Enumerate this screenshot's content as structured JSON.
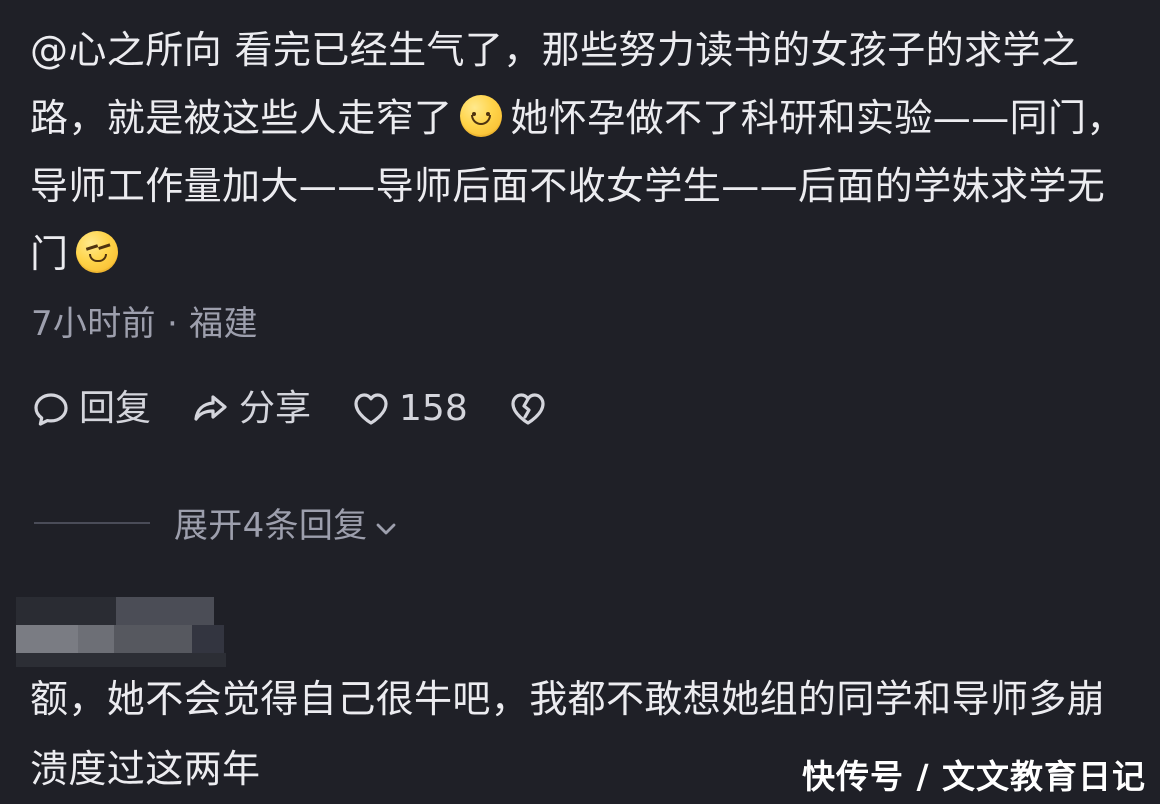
{
  "comment": {
    "text_part1": "@心之所向 看完已经生气了，那些努力读书的女孩子的求学之路，就是被这些人走窄了",
    "emoji1": "smile-face-emoji",
    "text_part2": "她怀孕做不了科研和实验——同门，导师工作量加大——导师后面不收女学生——后面的学妹求学无门",
    "emoji2": "wink-face-emoji",
    "meta": "7小时前 · 福建"
  },
  "actions": {
    "reply_label": "回复",
    "share_label": "分享",
    "like_count": "158",
    "reply_icon": "speech-bubble-icon",
    "share_icon": "share-arrow-icon",
    "like_icon": "heart-icon",
    "dislike_icon": "broken-heart-icon"
  },
  "thread": {
    "expand_label": "展开4条回复",
    "expand_icon": "chevron-down-icon"
  },
  "reply": {
    "text": "额，她不会觉得自己很牛吧，我都不敢想她组的同学和导师多崩溃度过这两年"
  },
  "watermark": {
    "text": "快传号 / 文文教育日记"
  },
  "colors": {
    "background": "#1f2027",
    "primary_text": "#ececf0",
    "secondary_text": "#9d9fad",
    "divider": "#4a4c58",
    "emoji_yellow": "#ffd44a"
  }
}
